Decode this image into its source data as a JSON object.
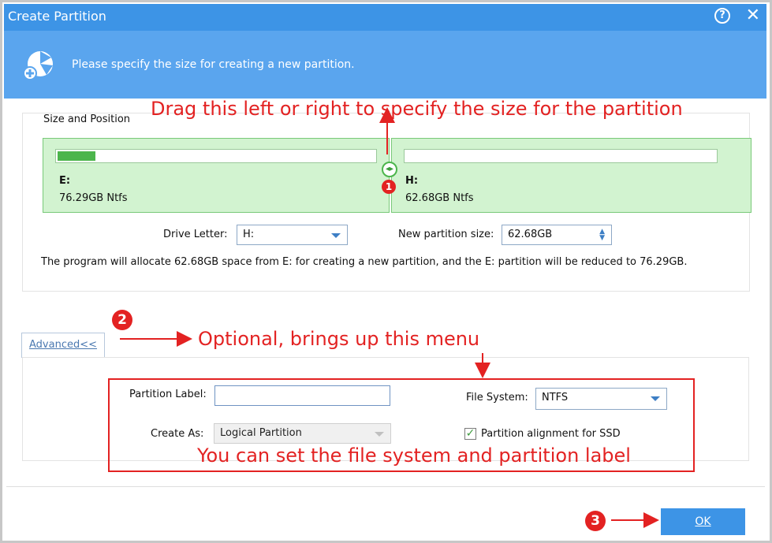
{
  "window": {
    "title": "Create Partition",
    "help_icon": "?",
    "close_icon": "✕"
  },
  "header": {
    "text": "Please specify the size for creating a new partition."
  },
  "size_position": {
    "group_label": "Size and Position",
    "left_partition": {
      "drive": "E:",
      "info": "76.29GB Ntfs",
      "used_fraction": 0.12
    },
    "right_partition": {
      "drive": "H:",
      "info": "62.68GB Ntfs",
      "used_fraction": 0
    },
    "drive_letter_label": "Drive Letter:",
    "drive_letter_value": "H:",
    "new_size_label": "New partition size:",
    "new_size_value": "62.68GB",
    "note": "The program will allocate 62.68GB space from E: for creating a new partition, and the E: partition will be reduced to 76.29GB."
  },
  "advanced": {
    "button_label": "Advanced<<",
    "partition_label_label": "Partition Label:",
    "partition_label_value": "",
    "file_system_label": "File System:",
    "file_system_value": "NTFS",
    "create_as_label": "Create As:",
    "create_as_value": "Logical Partition",
    "ssd_alignment_label": "Partition alignment for SSD",
    "ssd_alignment_checked": true
  },
  "ok_label": "OK",
  "annotations": {
    "drag_text": "Drag this left or right to specify the size  for the partition",
    "optional_text": "Optional, brings up this menu",
    "filesystem_text": "You can set the file system and partition label",
    "badge_1": "1",
    "badge_2": "2",
    "badge_3": "3"
  },
  "colors": {
    "accent": "#3d94e6",
    "header": "#5aa5ee",
    "partition_bg": "#d2f3d0",
    "annotation": "#e32222"
  }
}
